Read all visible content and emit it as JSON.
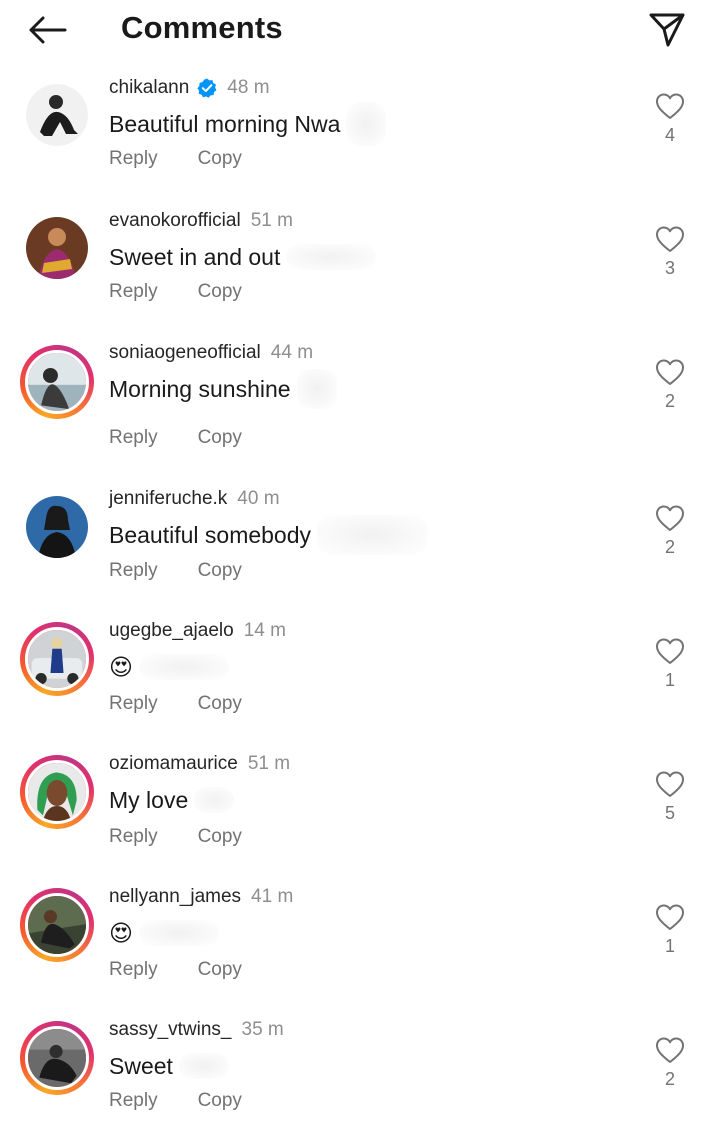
{
  "header": {
    "title": "Comments"
  },
  "comments": [
    {
      "username": "chikalann",
      "verified": true,
      "time": "48 m",
      "text": "Beautiful morning Nwa",
      "reply": "Reply",
      "copy": "Copy",
      "likes": "4",
      "story_ring": false
    },
    {
      "username": "evanokorofficial",
      "verified": false,
      "time": "51 m",
      "text": "Sweet in and out",
      "reply": "Reply",
      "copy": "Copy",
      "likes": "3",
      "story_ring": false
    },
    {
      "username": "soniaogeneofficial",
      "verified": false,
      "time": "44 m",
      "text": "Morning sunshine",
      "reply": "Reply",
      "copy": "Copy",
      "likes": "2",
      "story_ring": true
    },
    {
      "username": "jenniferuche.k",
      "verified": false,
      "time": "40 m",
      "text": "Beautiful somebody",
      "reply": "Reply",
      "copy": "Copy",
      "likes": "2",
      "story_ring": false
    },
    {
      "username": "ugegbe_ajaelo",
      "verified": false,
      "time": "14 m",
      "text": "😍",
      "reply": "Reply",
      "copy": "Copy",
      "likes": "1",
      "story_ring": true
    },
    {
      "username": "oziomamaurice",
      "verified": false,
      "time": "51 m",
      "text": "My love",
      "reply": "Reply",
      "copy": "Copy",
      "likes": "5",
      "story_ring": true
    },
    {
      "username": "nellyann_james",
      "verified": false,
      "time": "41 m",
      "text": "😍",
      "reply": "Reply",
      "copy": "Copy",
      "likes": "1",
      "story_ring": true
    },
    {
      "username": "sassy_vtwins_",
      "verified": false,
      "time": "35 m",
      "text": "Sweet",
      "reply": "Reply",
      "copy": "Copy",
      "likes": "2",
      "story_ring": true
    }
  ],
  "colors": {
    "verified": "#0095f6",
    "text": "#262626",
    "muted": "#8e8e8e"
  },
  "icons": {
    "back": "arrow-left-icon",
    "share": "paper-plane-icon",
    "like": "heart-outline-icon",
    "verified": "verified-badge-icon"
  }
}
